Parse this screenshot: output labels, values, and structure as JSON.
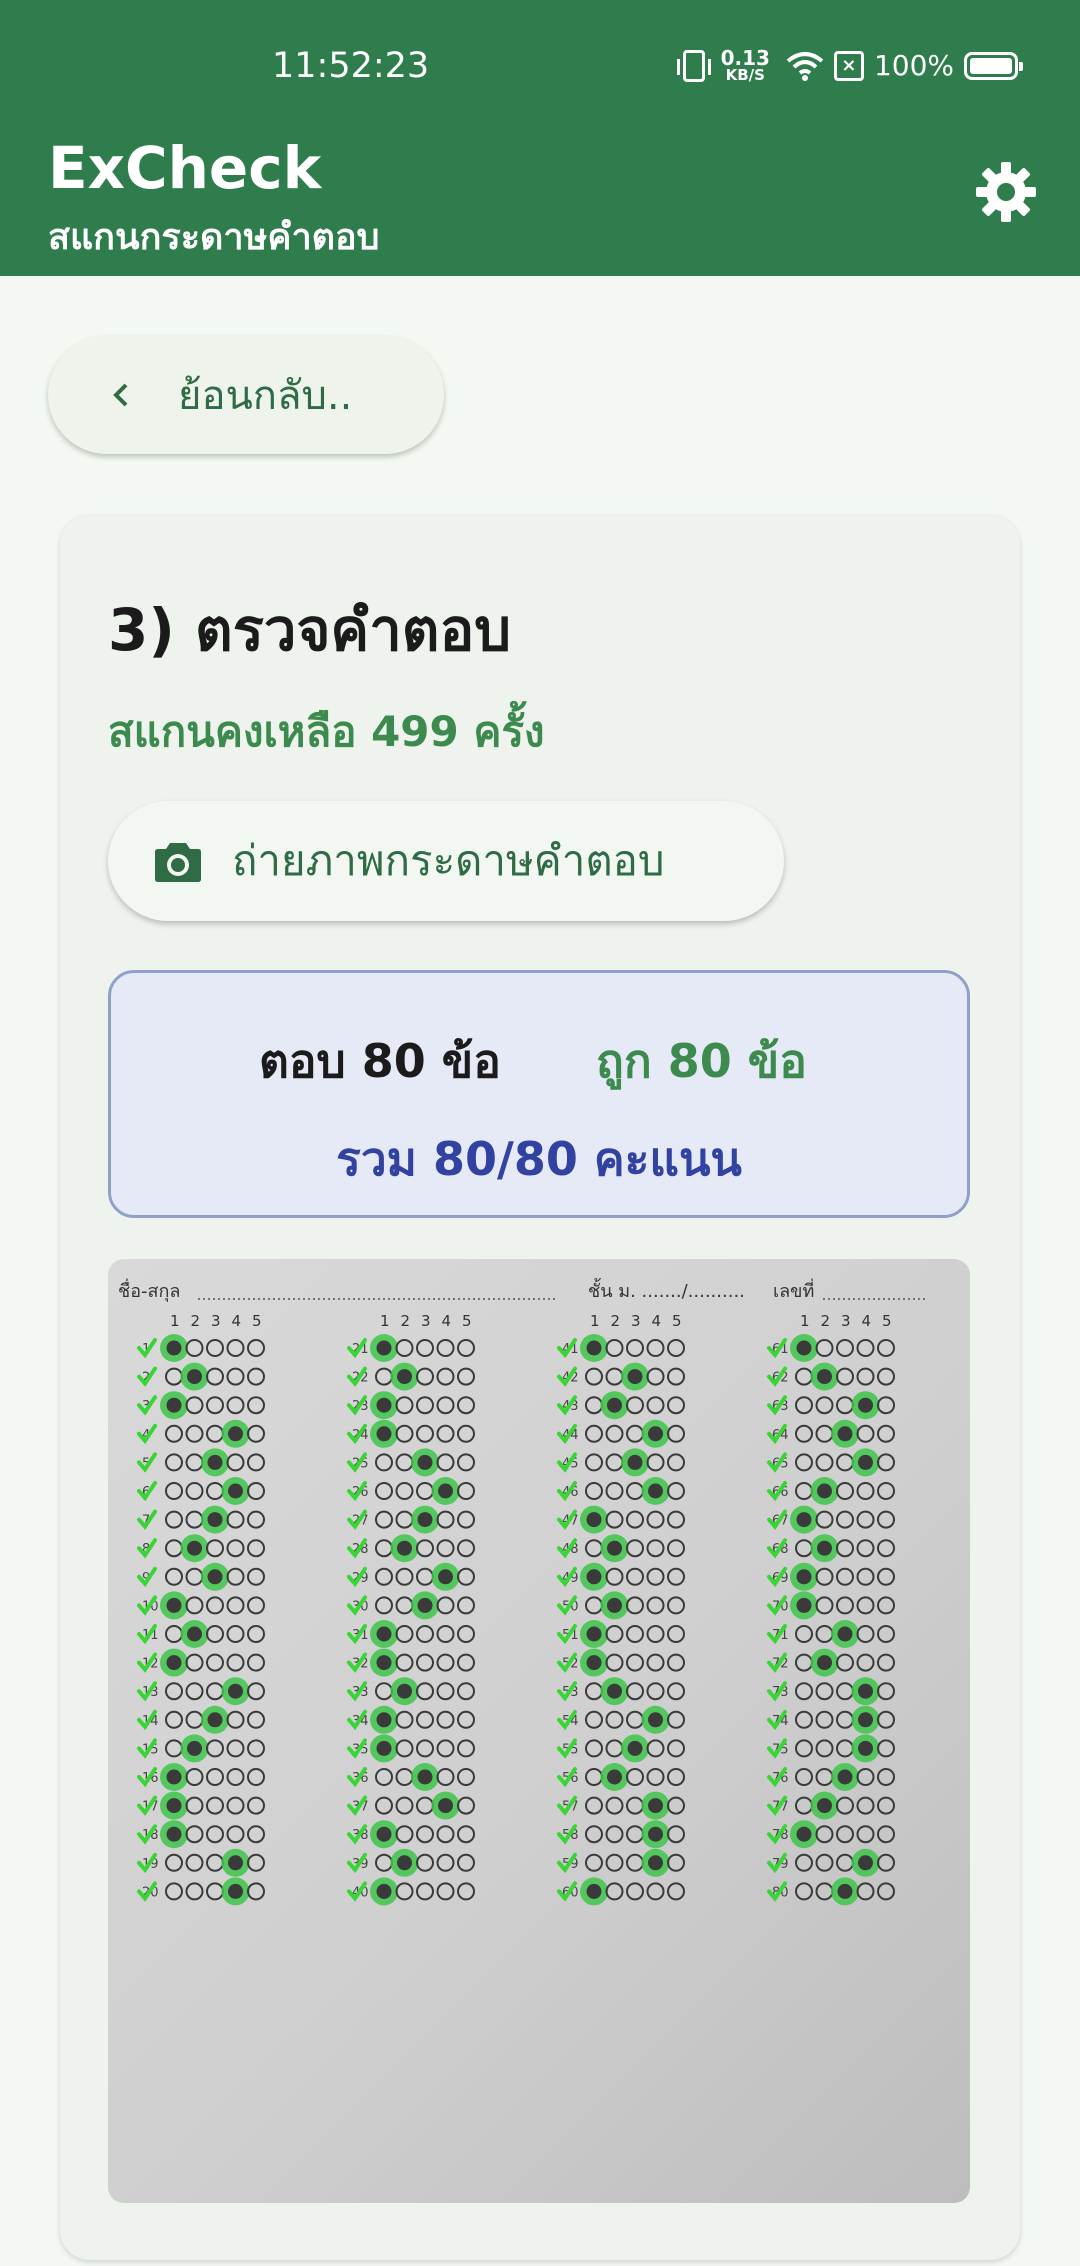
{
  "status_bar": {
    "time": "11:52:23",
    "net_speed_value": "0.13",
    "net_speed_unit": "KB/S",
    "battery": "100%"
  },
  "app_bar": {
    "title": "ExCheck",
    "subtitle": "สแกนกระดาษคำตอบ",
    "settings_icon": "gear-icon"
  },
  "back_button": {
    "label": "ย้อนกลับ..",
    "icon": "chevron-left-icon"
  },
  "card": {
    "title": "3) ตรวจคำตอบ",
    "remaining": "สแกนคงเหลือ 499 ครั้ง",
    "camera_button": {
      "label": "ถ่ายภาพกระดาษคำตอบ",
      "icon": "camera-icon"
    },
    "result": {
      "answered": "ตอบ 80 ข้อ",
      "correct": "ถูก 80 ข้อ",
      "total": "รวม 80/80 คะแนน"
    }
  },
  "answer_sheet": {
    "header_name_label": "ชื่อ-สกุล",
    "header_class_label": "ชั้น ม. ......./..........",
    "header_number_label": "เลขที่",
    "choice_labels": [
      "1",
      "2",
      "3",
      "4",
      "5"
    ],
    "columns": [
      {
        "answers": [
          1,
          2,
          1,
          4,
          3,
          4,
          3,
          2,
          3,
          1,
          2,
          1,
          4,
          3,
          2,
          1,
          1,
          1,
          4,
          4
        ]
      },
      {
        "answers": [
          1,
          2,
          1,
          1,
          3,
          4,
          3,
          2,
          4,
          3,
          1,
          1,
          2,
          1,
          1,
          3,
          4,
          1,
          2,
          1
        ]
      },
      {
        "answers": [
          1,
          3,
          2,
          4,
          3,
          4,
          1,
          2,
          1,
          2,
          1,
          1,
          2,
          4,
          3,
          2,
          4,
          4,
          4,
          1
        ]
      },
      {
        "answers": [
          1,
          2,
          4,
          3,
          4,
          2,
          1,
          2,
          1,
          1,
          3,
          2,
          4,
          4,
          4,
          3,
          2,
          1,
          4,
          3
        ]
      }
    ],
    "colors": {
      "highlight": "#3ec44a",
      "filled_bubble": "#3a3a3a",
      "check": "#39d435"
    }
  }
}
